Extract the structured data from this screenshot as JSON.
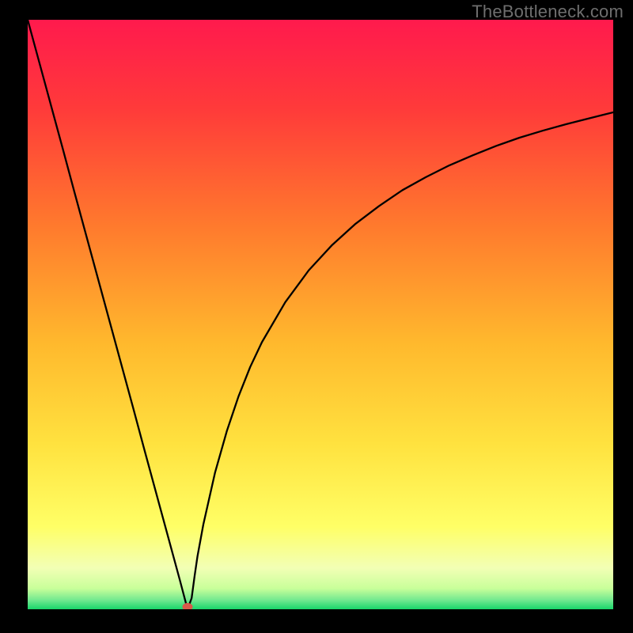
{
  "watermark": "TheBottleneck.com",
  "colors": {
    "frame": "#000000",
    "gradient_stops": [
      {
        "offset": 0.0,
        "color": "#ff1a4d"
      },
      {
        "offset": 0.15,
        "color": "#ff3a3a"
      },
      {
        "offset": 0.35,
        "color": "#ff7a2d"
      },
      {
        "offset": 0.55,
        "color": "#ffb92d"
      },
      {
        "offset": 0.72,
        "color": "#ffe23f"
      },
      {
        "offset": 0.86,
        "color": "#ffff66"
      },
      {
        "offset": 0.93,
        "color": "#f2ffb5"
      },
      {
        "offset": 0.965,
        "color": "#c8ff9a"
      },
      {
        "offset": 0.985,
        "color": "#6fe88f"
      },
      {
        "offset": 1.0,
        "color": "#18d66a"
      }
    ],
    "curve": "#000000",
    "marker": "#d95a4a"
  },
  "chart_data": {
    "type": "line",
    "title": "",
    "xlabel": "",
    "ylabel": "",
    "x": [
      0.0,
      0.02,
      0.04,
      0.06,
      0.08,
      0.1,
      0.12,
      0.14,
      0.16,
      0.18,
      0.2,
      0.22,
      0.24,
      0.26,
      0.273,
      0.28,
      0.285,
      0.29,
      0.3,
      0.32,
      0.34,
      0.36,
      0.38,
      0.4,
      0.44,
      0.48,
      0.52,
      0.56,
      0.6,
      0.64,
      0.68,
      0.72,
      0.76,
      0.8,
      0.84,
      0.88,
      0.92,
      0.96,
      1.0
    ],
    "values": [
      1.0,
      0.927,
      0.854,
      0.781,
      0.707,
      0.634,
      0.561,
      0.488,
      0.415,
      0.342,
      0.268,
      0.195,
      0.122,
      0.049,
      0.0,
      0.019,
      0.056,
      0.09,
      0.144,
      0.232,
      0.302,
      0.361,
      0.411,
      0.453,
      0.521,
      0.575,
      0.618,
      0.654,
      0.684,
      0.711,
      0.733,
      0.753,
      0.77,
      0.786,
      0.8,
      0.812,
      0.823,
      0.833,
      0.843
    ],
    "xlim": [
      0,
      1
    ],
    "ylim": [
      0,
      1
    ],
    "marker": {
      "x": 0.273,
      "y": 0.0
    }
  }
}
